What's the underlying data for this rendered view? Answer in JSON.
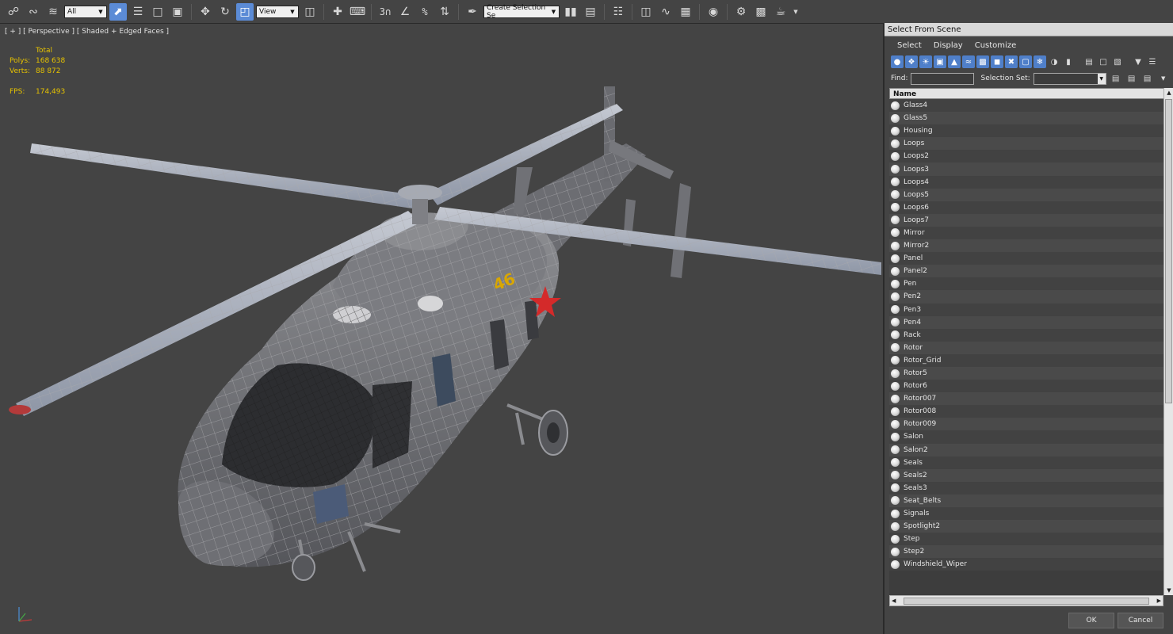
{
  "toolbar": {
    "selection_filter": "All",
    "reference_coord": "View",
    "selection_set_placeholder": "Create Selection Se",
    "icons": [
      "link-icon",
      "unlink-icon",
      "bind-spacewarp-icon",
      "select-object-icon",
      "select-by-name-icon",
      "rect-selection-icon",
      "window-crossing-icon",
      "move-icon",
      "rotate-icon",
      "scale-icon",
      "use-pivot-icon",
      "select-manipulate-icon",
      "keyboard-shortcut-icon",
      "snap-3d-icon",
      "angle-snap-icon",
      "percent-snap-icon",
      "spinner-snap-icon",
      "edit-named-selection-icon",
      "mirror-icon",
      "align-icon",
      "layer-icon",
      "graphite-icon",
      "curve-editor-icon",
      "schematic-view-icon",
      "material-editor-icon",
      "render-setup-icon",
      "rendered-frame-icon",
      "render-icon"
    ]
  },
  "viewport": {
    "label": "[ + ] [ Perspective ] [ Shaded + Edged Faces ]",
    "stats": {
      "header": "Total",
      "polys_label": "Polys:",
      "polys_value": "168 638",
      "verts_label": "Verts:",
      "verts_value": "88 872",
      "fps_label": "FPS:",
      "fps_value": "174,493"
    },
    "tail_number": "46",
    "colors": {
      "background": "#444444",
      "stats_text": "#e6c200",
      "star": "#d42a2a"
    }
  },
  "dialog": {
    "title": "Select From Scene",
    "menu": [
      "Select",
      "Display",
      "Customize"
    ],
    "find_label": "Find:",
    "selection_set_label": "Selection Set:",
    "column_header": "Name",
    "items": [
      "Glass4",
      "Glass5",
      "Housing",
      "Loops",
      "Loops2",
      "Loops3",
      "Loops4",
      "Loops5",
      "Loops6",
      "Loops7",
      "Mirror",
      "Mirror2",
      "Panel",
      "Panel2",
      "Pen",
      "Pen2",
      "Pen3",
      "Pen4",
      "Rack",
      "Rotor",
      "Rotor_Grid",
      "Rotor5",
      "Rotor6",
      "Rotor007",
      "Rotor008",
      "Rotor009",
      "Salon",
      "Salon2",
      "Seals",
      "Seals2",
      "Seals3",
      "Seat_Belts",
      "Signals",
      "Spotlight2",
      "Step",
      "Step2",
      "Windshield_Wiper"
    ],
    "ok_label": "OK",
    "cancel_label": "Cancel"
  }
}
